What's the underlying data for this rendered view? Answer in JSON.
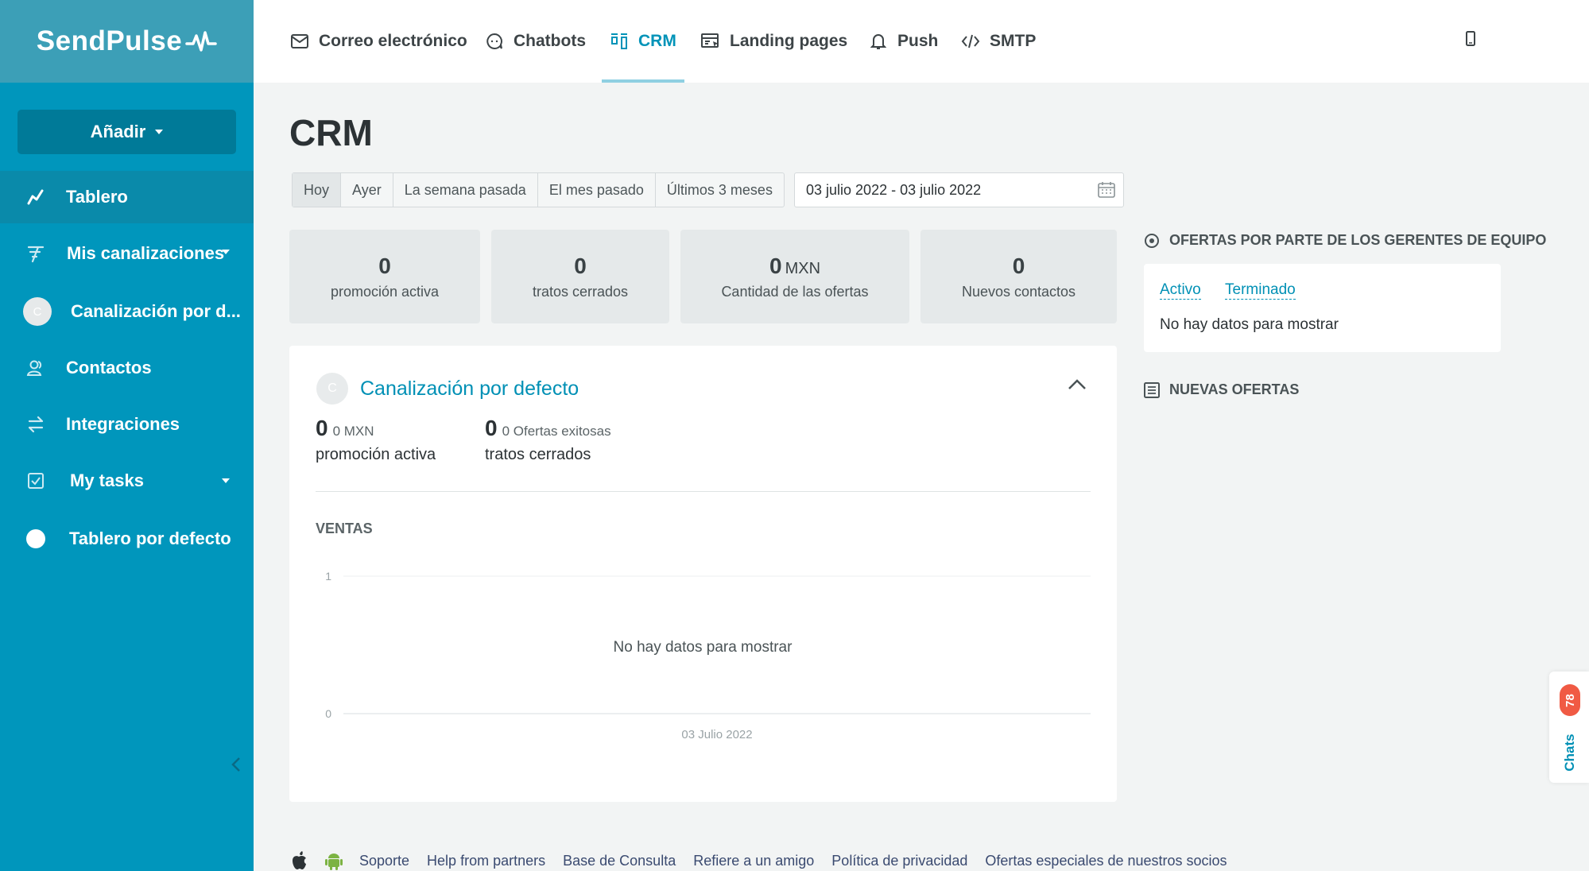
{
  "brand": {
    "logo_text": "SendPulse"
  },
  "sidebar": {
    "add_label": "Añadir",
    "items": [
      {
        "label": "Tablero",
        "icon": "chart-line-icon"
      },
      {
        "label": "Mis canalizaciones",
        "icon": "funnel-icon"
      },
      {
        "label": "Canalización por d...",
        "icon": "avatar-c",
        "avatar_letter": "C"
      },
      {
        "label": "Contactos",
        "icon": "contacts-icon"
      },
      {
        "label": "Integraciones",
        "icon": "arrows-exchange-icon"
      },
      {
        "label": "My tasks",
        "icon": "checkbox-icon"
      },
      {
        "label": "Tablero por defecto",
        "icon": "white-dot-icon"
      }
    ]
  },
  "topnav": {
    "tabs": [
      {
        "label": "Correo electrónico",
        "icon": "mail-icon"
      },
      {
        "label": "Chatbots",
        "icon": "chat-bubble-icon"
      },
      {
        "label": "CRM",
        "icon": "kanban-icon"
      },
      {
        "label": "Landing pages",
        "icon": "landing-page-icon"
      },
      {
        "label": "Push",
        "icon": "bell-icon"
      },
      {
        "label": "SMTP",
        "icon": "code-icon"
      }
    ],
    "active_tab": "CRM"
  },
  "main": {
    "title": "CRM",
    "periods": [
      "Hoy",
      "Ayer",
      "La semana pasada",
      "El mes pasado",
      "Últimos 3 meses"
    ],
    "selected_period": "Hoy",
    "date_range": "03 julio 2022 - 03 julio 2022",
    "stats": [
      {
        "value": "0",
        "unit": "",
        "caption": "promoción activa"
      },
      {
        "value": "0",
        "unit": "",
        "caption": "tratos cerrados"
      },
      {
        "value": "0",
        "unit": "MXN",
        "caption": "Cantidad de las ofertas"
      },
      {
        "value": "0",
        "unit": "",
        "caption": "Nuevos contactos"
      }
    ],
    "pipeline": {
      "avatar_letter": "C",
      "name": "Canalización por defecto",
      "metrics": [
        {
          "value": "0",
          "sub": "0 MXN",
          "caption": "promoción activa"
        },
        {
          "value": "0",
          "sub": "0 Ofertas exitosas",
          "caption": "tratos cerrados"
        }
      ],
      "sales_label": "VENTAS"
    }
  },
  "chart_data": {
    "type": "line",
    "title": "VENTAS",
    "categories": [
      "03 Julio 2022"
    ],
    "series": [],
    "ylim": [
      0,
      1
    ],
    "yticks": [
      "1",
      "0"
    ],
    "empty_message": "No hay datos para mostrar",
    "grid": true
  },
  "right": {
    "offers_title": "OFERTAS POR PARTE DE LOS GERENTES DE EQUIPO",
    "offers_tabs": [
      "Activo",
      "Terminado"
    ],
    "offers_empty": "No hay datos para mostrar",
    "new_offers_title": "NUEVAS OFERTAS"
  },
  "chats": {
    "label": "Chats",
    "count": "78"
  },
  "footer": {
    "links": [
      "Soporte",
      "Help from partners",
      "Base de Consulta",
      "Refiere a un amigo",
      "Política de privacidad",
      "Ofertas especiales de nuestros socios"
    ]
  },
  "colors": {
    "brand": "#0096bc",
    "accent": "#0090b5",
    "badge": "#f05a44"
  }
}
